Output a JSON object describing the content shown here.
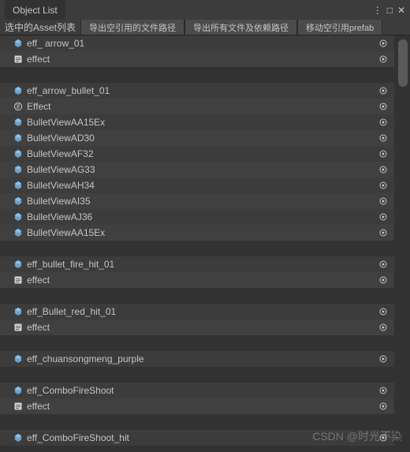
{
  "window": {
    "title": "Object List",
    "menu_icon": "⋮",
    "maximize_icon": "□",
    "close_icon": "✕"
  },
  "header": {
    "label": "选中的Asset列表",
    "btn1": "导出空引用的文件路径",
    "btn2": "导出所有文件及依赖路径",
    "btn3": "移动空引用prefab"
  },
  "groups": [
    {
      "items": [
        {
          "icon": "prefab",
          "name": "eff_ arrow_01"
        },
        {
          "icon": "gameobject",
          "name": "effect"
        }
      ]
    },
    {
      "items": [
        {
          "icon": "prefab",
          "name": "eff_arrow_bullet_01"
        },
        {
          "icon": "gameobject-alt",
          "name": "Effect"
        },
        {
          "icon": "prefab",
          "name": "BulletViewAA15Ex"
        },
        {
          "icon": "prefab",
          "name": "BulletViewAD30"
        },
        {
          "icon": "prefab",
          "name": "BulletViewAF32"
        },
        {
          "icon": "prefab",
          "name": "BulletViewAG33"
        },
        {
          "icon": "prefab",
          "name": "BulletViewAH34"
        },
        {
          "icon": "prefab",
          "name": "BulletViewAI35"
        },
        {
          "icon": "prefab",
          "name": "BulletViewAJ36"
        },
        {
          "icon": "prefab",
          "name": "BulletViewAA15Ex"
        }
      ]
    },
    {
      "items": [
        {
          "icon": "prefab",
          "name": "eff_bullet_fire_hit_01"
        },
        {
          "icon": "gameobject",
          "name": "effect"
        }
      ]
    },
    {
      "items": [
        {
          "icon": "prefab",
          "name": "eff_Bullet_red_hit_01"
        },
        {
          "icon": "gameobject",
          "name": "effect"
        }
      ]
    },
    {
      "items": [
        {
          "icon": "prefab",
          "name": "eff_chuansongmeng_purple"
        }
      ]
    },
    {
      "items": [
        {
          "icon": "prefab",
          "name": "eff_ComboFireShoot"
        },
        {
          "icon": "gameobject",
          "name": "effect"
        }
      ]
    },
    {
      "items": [
        {
          "icon": "prefab",
          "name": "eff_ComboFireShoot_hit"
        }
      ]
    }
  ],
  "watermark": "CSDN @时光不染"
}
